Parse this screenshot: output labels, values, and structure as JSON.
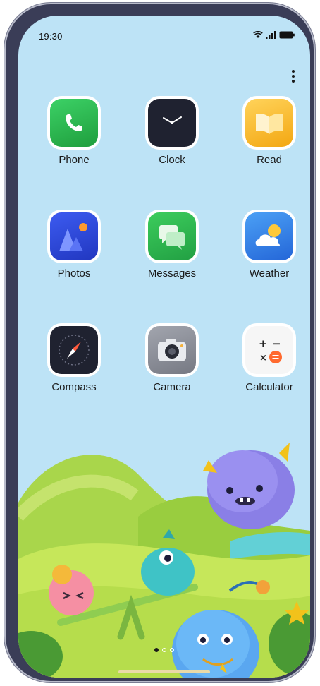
{
  "status_bar": {
    "time": "19:30"
  },
  "apps": [
    {
      "id": "phone",
      "label": "Phone",
      "icon": "phone-icon",
      "color": "#2bb24c"
    },
    {
      "id": "clock",
      "label": "Clock",
      "icon": "clock-icon",
      "color": "#1f2230"
    },
    {
      "id": "read",
      "label": "Read",
      "icon": "book-icon",
      "color": "#f7b51b"
    },
    {
      "id": "photos",
      "label": "Photos",
      "icon": "photos-icon",
      "color": "#2a4bd8"
    },
    {
      "id": "messages",
      "label": "Messages",
      "icon": "messages-icon",
      "color": "#2fb14f"
    },
    {
      "id": "weather",
      "label": "Weather",
      "icon": "weather-icon",
      "color": "#2f7fe6"
    },
    {
      "id": "compass",
      "label": "Compass",
      "icon": "compass-icon",
      "color": "#1f2230"
    },
    {
      "id": "camera",
      "label": "Camera",
      "icon": "camera-icon",
      "color": "#8a8d96"
    },
    {
      "id": "calculator",
      "label": "Calculator",
      "icon": "calculator-icon",
      "color": "#f6f6f6"
    }
  ],
  "page_indicator": {
    "pages": 3,
    "active": 1
  },
  "wallpaper": {
    "sky": "#bde3f6",
    "hills": "#8cc83a"
  }
}
